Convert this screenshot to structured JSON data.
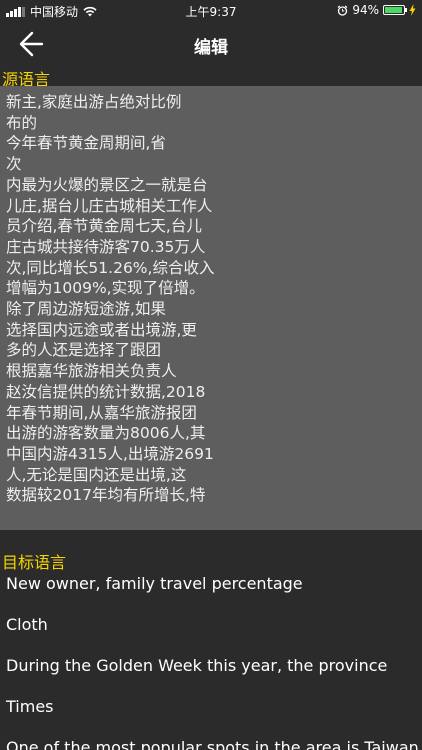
{
  "status_bar": {
    "carrier": "中国移动",
    "time": "上午9:37",
    "battery_percent": "94%",
    "battery_level": 0.94,
    "battery_color": "#4cd964"
  },
  "nav": {
    "back_icon": "arrow-left-icon",
    "title": "编辑"
  },
  "source": {
    "label": "源语言",
    "lines": [
      "新主,家庭出游占绝对比例",
      "布的",
      "今年春节黄金周期间,省",
      "次",
      "内最为火爆的景区之一就是台",
      "儿庄,据台儿庄古城相关工作人",
      "员介绍,春节黄金周七天,台儿",
      "庄古城共接待游客70.35万人",
      "次,同比增长51.26%,综合收入",
      "增幅为1009%,实现了倍增。",
      "除了周边游短途游,如果",
      "选择国内远途或者出境游,更",
      "多的人还是选择了跟团",
      "根据嘉华旅游相关负责人",
      "赵汝信提供的统计数据,2018",
      "年春节期间,从嘉华旅游报团",
      "出游的游客数量为8006人,其",
      "中国内游4315人,出境游2691",
      "人,无论是国内还是出境,这",
      "数据较2017年均有所增长,特"
    ]
  },
  "target": {
    "label": "目标语言",
    "lines": [
      "New owner, family travel percentage",
      "Cloth",
      "During the Golden Week this year, the province",
      "Times",
      "One of the most popular spots in the area is Taiwan"
    ]
  },
  "colors": {
    "background": "#2b2b2b",
    "source_box": "#5e5e5e",
    "label_accent": "#f5d400"
  }
}
